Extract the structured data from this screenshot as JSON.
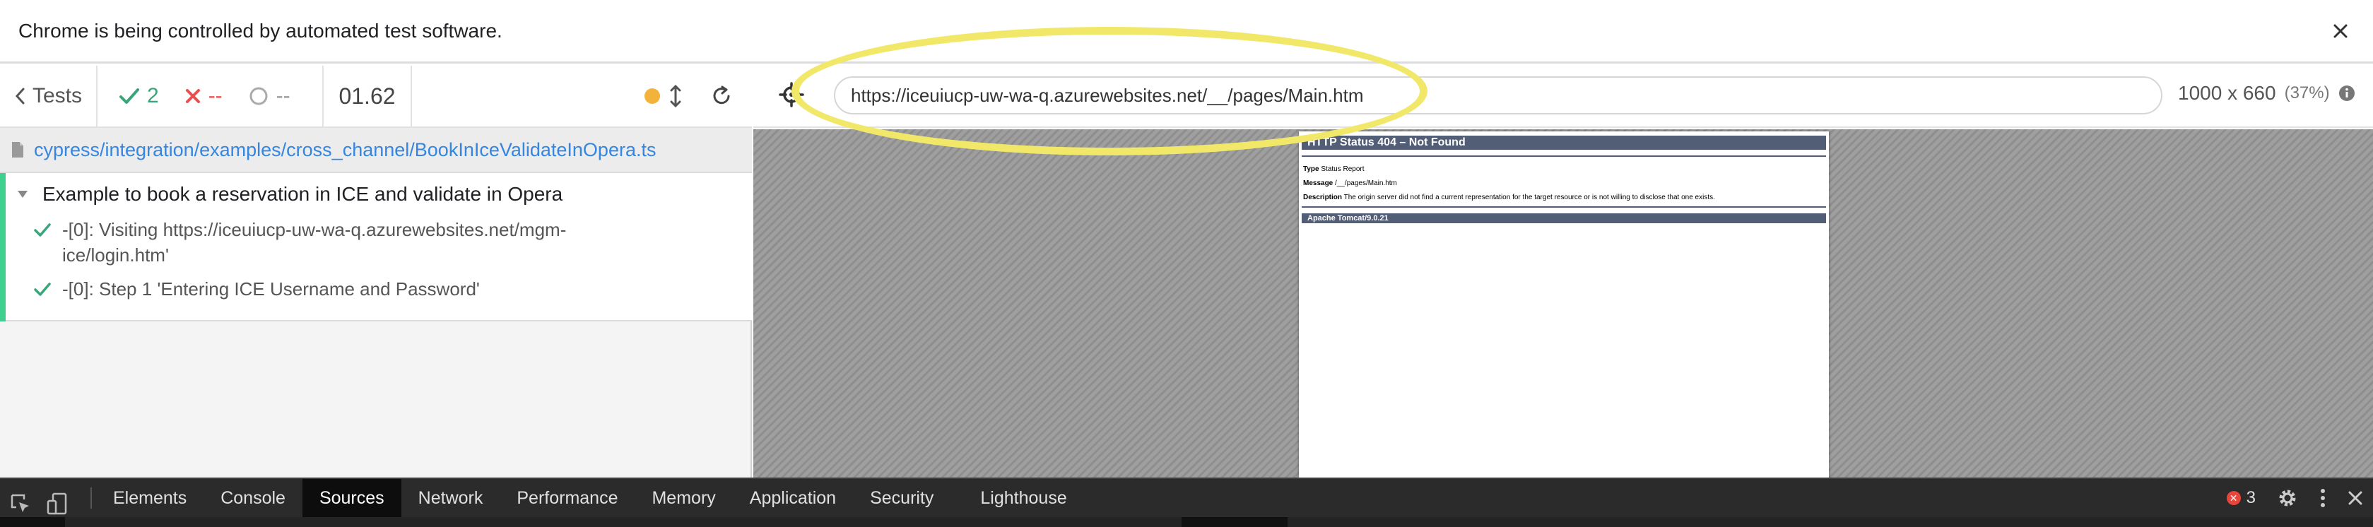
{
  "infobar": {
    "message": "Chrome is being controlled by automated test software."
  },
  "reporter": {
    "tests_label": "Tests",
    "passed": "2",
    "failed": "--",
    "pending": "--",
    "duration": "01.62",
    "spec_path": "cypress/integration/examples/cross_channel/BookInIceValidateInOpera.ts",
    "suite_title": "Example to book a reservation in ICE and validate in Opera",
    "tests": [
      {
        "title": "-[0]: Visiting https://iceuiucp-uw-wa-q.azurewebsites.net/mgm-ice/login.htm'"
      },
      {
        "title": "-[0]: Step 1 'Entering ICE Username and Password'"
      }
    ]
  },
  "aut": {
    "url": "https://iceuiucp-uw-wa-q.azurewebsites.net/__/pages/Main.htm",
    "viewport_size": "1000 x 660",
    "viewport_scale": "(37%)",
    "error_page": {
      "title": "HTTP Status 404 – Not Found",
      "type_label": "Type",
      "type_value": "Status Report",
      "message_label": "Message",
      "message_value": "/__/pages/Main.htm",
      "description_label": "Description",
      "description_value": "The origin server did not find a current representation for the target resource or is not willing to disclose that one exists.",
      "footer": "Apache Tomcat/9.0.21"
    }
  },
  "devtools": {
    "tabs": [
      {
        "label": "Elements"
      },
      {
        "label": "Console"
      },
      {
        "label": "Sources"
      },
      {
        "label": "Network"
      },
      {
        "label": "Performance"
      },
      {
        "label": "Memory"
      },
      {
        "label": "Application"
      },
      {
        "label": "Security"
      },
      {
        "label": "Lighthouse"
      }
    ],
    "active_tab": "Sources",
    "error_count": "3"
  },
  "colors": {
    "pass": "#3aa57a",
    "fail": "#e94f4f",
    "link": "#3486e0",
    "highlight": "#f1e86a"
  }
}
